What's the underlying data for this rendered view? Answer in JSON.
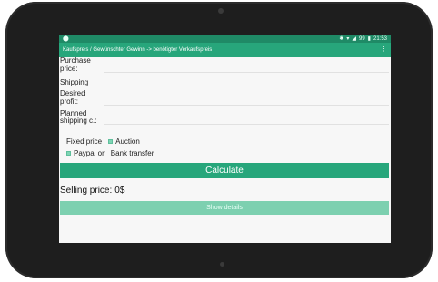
{
  "statusbar": {
    "left_icon": "android-icon",
    "icons": [
      "bluetooth-icon",
      "wifi-icon",
      "signal-icon",
      "battery-icon"
    ],
    "time": "21:53",
    "battery": "99"
  },
  "appbar": {
    "title": "Kaufspreis / Gewünschter Gewinn -> benötigter Verkaufspreis",
    "overflow_icon": "⋮"
  },
  "form": {
    "purchase_label": "Purchase price:",
    "shipping_label": "Shipping",
    "profit_label": "Desired profit:",
    "planned_shipping_label": "Planned shipping c.:"
  },
  "options": {
    "fixed_price": "Fixed price",
    "auction": "Auction",
    "paypal": "Paypal or",
    "bank_transfer": "Bank transfer"
  },
  "calculate_label": "Calculate",
  "result": {
    "label": "Selling price:",
    "value": "0$"
  },
  "details_label": "Show details",
  "colors": {
    "primary": "#27a67b",
    "primary_dark": "#1f8a66",
    "primary_light": "#7dd0b0"
  }
}
